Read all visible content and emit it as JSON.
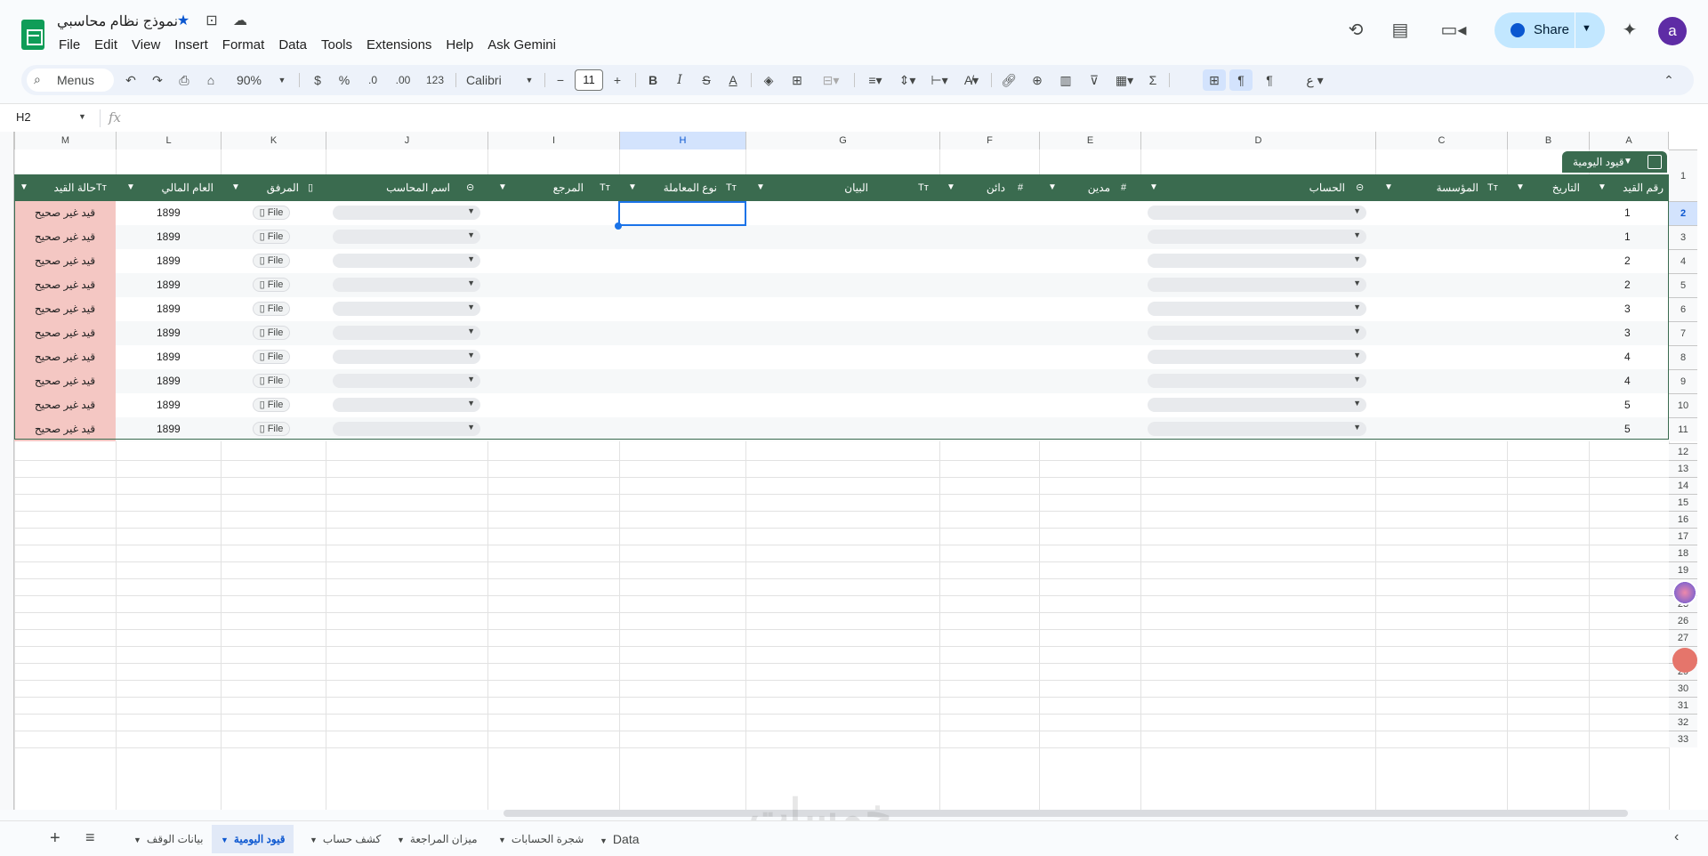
{
  "header": {
    "title": "نموذج نظام محاسبي",
    "menu": [
      "File",
      "Edit",
      "View",
      "Insert",
      "Format",
      "Data",
      "Tools",
      "Extensions",
      "Help",
      "Ask Gemini"
    ],
    "share_label": "Share",
    "avatar_letter": "a"
  },
  "toolbar": {
    "menus_label": "Menus",
    "zoom": "90%",
    "currency": "$",
    "percent": "%",
    "dec_decrease": ".0",
    "dec_increase": ".00",
    "number_format": "123",
    "font": "Calibri",
    "font_size": "11",
    "bold": "B",
    "italic": "I",
    "strike": "S",
    "text_color": "A",
    "sum": "Σ"
  },
  "formula_bar": {
    "cell_ref": "H2",
    "fx": "fx",
    "value": ""
  },
  "grid": {
    "columns": [
      "M",
      "L",
      "K",
      "J",
      "I",
      "H",
      "G",
      "F",
      "E",
      "D",
      "C",
      "B",
      "A"
    ],
    "selected_column": "H",
    "row_numbers": [
      "1",
      "2",
      "3",
      "4",
      "5",
      "6",
      "7",
      "8",
      "9",
      "10",
      "11",
      "12",
      "13",
      "14",
      "15",
      "16",
      "17",
      "18",
      "19",
      "22",
      "23",
      "26",
      "27",
      "28",
      "29",
      "30",
      "31",
      "32",
      "33"
    ],
    "selected_row": "2",
    "table_name": "قيود اليومية",
    "table_headers": {
      "A": "رقم القيد",
      "B": "التاريخ",
      "C": "المؤسسة",
      "D": "الحساب",
      "E": "مدين",
      "F": "دائن",
      "G": "البيان",
      "H": "نوع المعاملة",
      "I": "المرجع",
      "J": "اسم المحاسب",
      "K": "المرفق",
      "L": "العام المالي",
      "M": "حالة القيد"
    },
    "type_icons": {
      "text": "Tт",
      "number": "#"
    },
    "rows": [
      {
        "entry_no": "1",
        "year": "1899",
        "status": "قيد غير صحيح",
        "file": "File"
      },
      {
        "entry_no": "1",
        "year": "1899",
        "status": "قيد غير صحيح",
        "file": "File"
      },
      {
        "entry_no": "2",
        "year": "1899",
        "status": "قيد غير صحيح",
        "file": "File"
      },
      {
        "entry_no": "2",
        "year": "1899",
        "status": "قيد غير صحيح",
        "file": "File"
      },
      {
        "entry_no": "3",
        "year": "1899",
        "status": "قيد غير صحيح",
        "file": "File"
      },
      {
        "entry_no": "3",
        "year": "1899",
        "status": "قيد غير صحيح",
        "file": "File"
      },
      {
        "entry_no": "4",
        "year": "1899",
        "status": "قيد غير صحيح",
        "file": "File"
      },
      {
        "entry_no": "4",
        "year": "1899",
        "status": "قيد غير صحيح",
        "file": "File"
      },
      {
        "entry_no": "5",
        "year": "1899",
        "status": "قيد غير صحيح",
        "file": "File"
      },
      {
        "entry_no": "5",
        "year": "1899",
        "status": "قيد غير صحيح",
        "file": "File"
      }
    ]
  },
  "sheet_tabs": [
    {
      "label": "بيانات الوقف",
      "active": false
    },
    {
      "label": "قيود اليومية",
      "active": true
    },
    {
      "label": "كشف حساب",
      "active": false
    },
    {
      "label": "ميزان المراجعة",
      "active": false
    },
    {
      "label": "شجرة الحسابات",
      "active": false
    },
    {
      "label": "Data",
      "active": false
    }
  ],
  "watermark": "خمسات",
  "colors": {
    "table_header": "#3a6b4f",
    "status_bad": "#f4c7c3",
    "selection": "#1a73e8",
    "share_bg": "#c2e7ff",
    "avatar_bg": "#5e2ca5"
  }
}
